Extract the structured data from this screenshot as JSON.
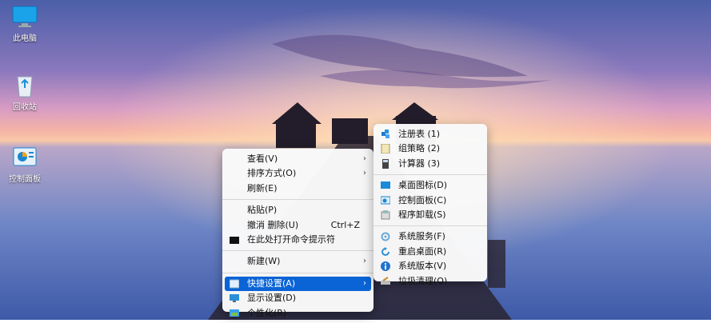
{
  "desktop": {
    "icons": [
      {
        "label": "此电脑",
        "icon": "computer-icon"
      },
      {
        "label": "回收站",
        "icon": "recycle-bin-icon"
      },
      {
        "label": "控制面板",
        "icon": "control-panel-icon"
      }
    ]
  },
  "context_menu": {
    "view": "查看(V)",
    "sort": "排序方式(O)",
    "refresh": "刷新(E)",
    "paste": "粘贴(P)",
    "undo": "撤消 删除(U)",
    "undo_shortcut": "Ctrl+Z",
    "cmd": "在此处打开命令提示符",
    "new": "新建(W)",
    "quick_settings": "快捷设置(A)",
    "display": "显示设置(D)",
    "personalize": "个性化(R)"
  },
  "submenu": {
    "registry": "注册表  (1)",
    "gpedit": "组策略  (2)",
    "calc": "计算器  (3)",
    "desktop_icons": "桌面图标(D)",
    "control_panel": "控制面板(C)",
    "uninstall": "程序卸载(S)",
    "services": "系统服务(F)",
    "restart_desktop": "重启桌面(R)",
    "version": "系统版本(V)",
    "cleanup": "垃圾清理(Q)"
  },
  "colors": {
    "highlight": "#0a64d6",
    "menu_bg": "#f9f9f9"
  }
}
